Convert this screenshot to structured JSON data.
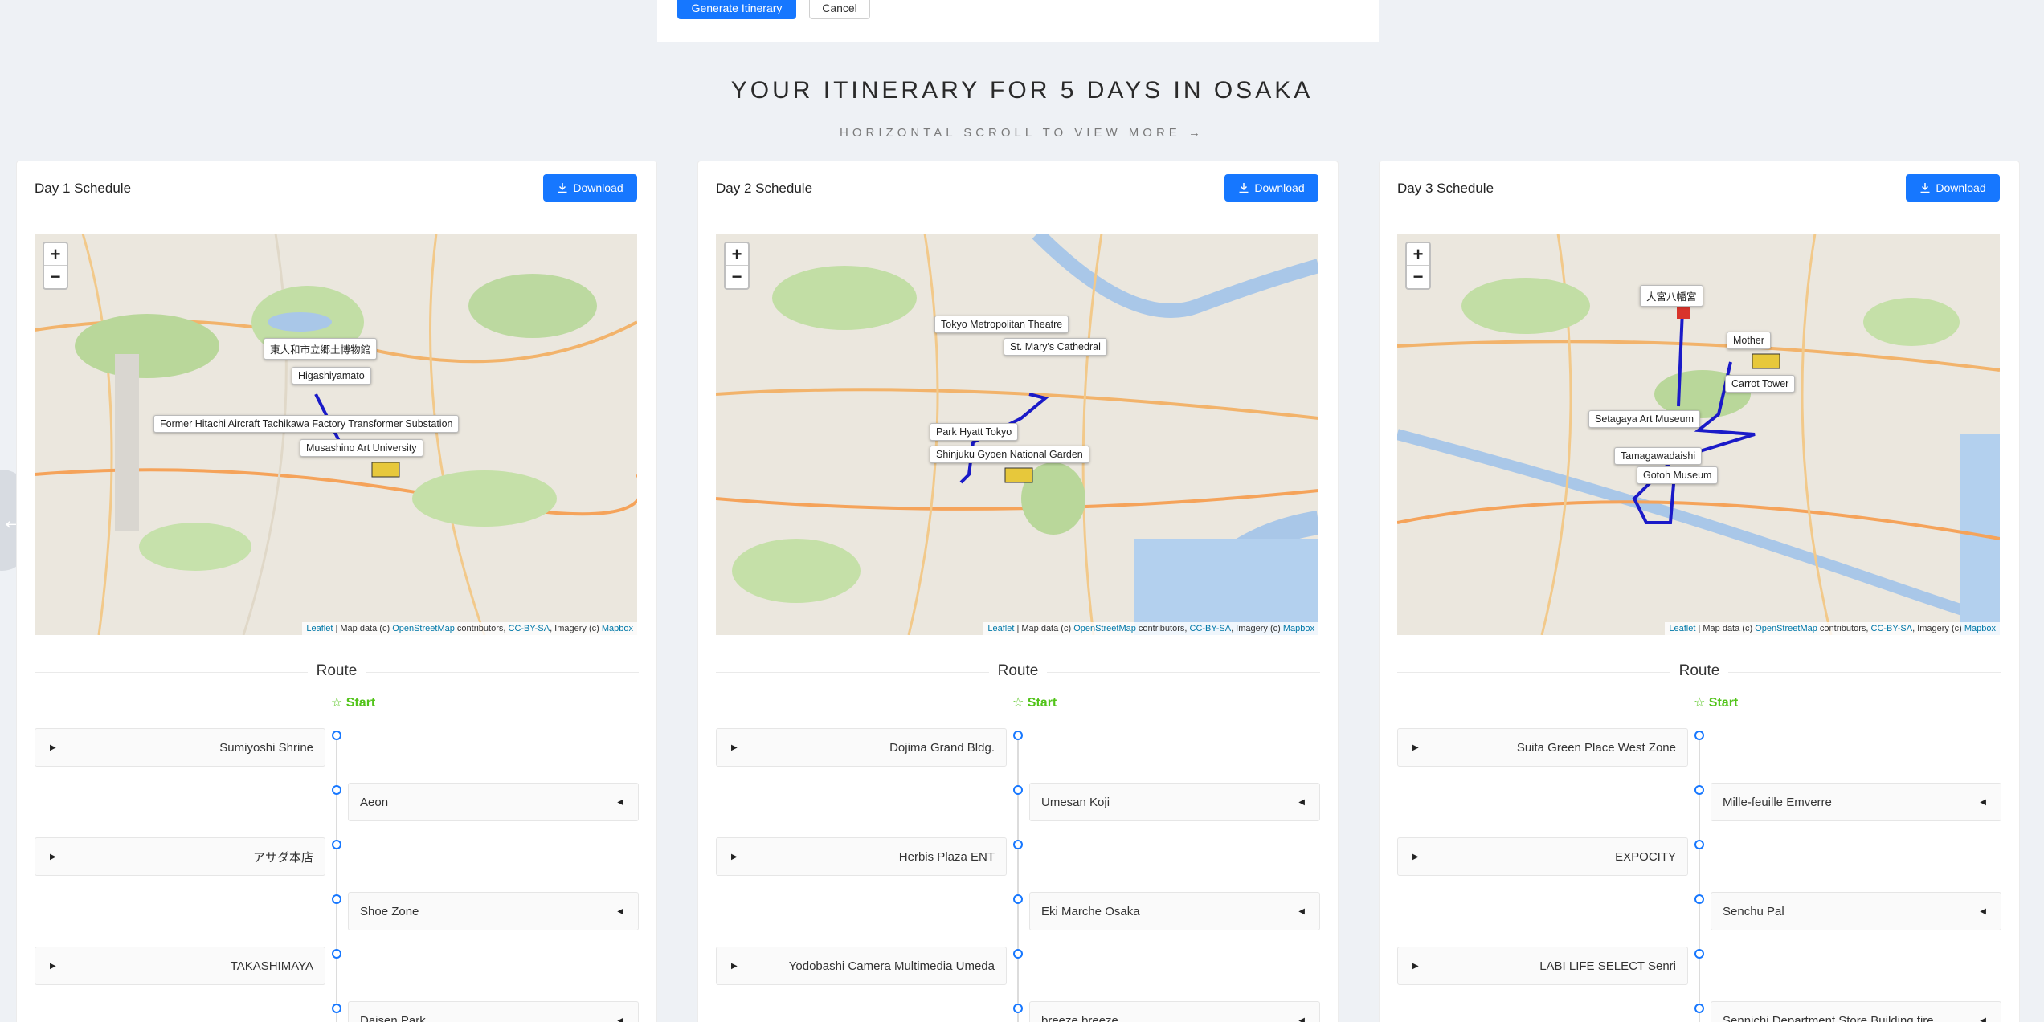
{
  "toolbar": {
    "generate_label": "Generate Itinerary",
    "cancel_label": "Cancel"
  },
  "heading": {
    "title": "YOUR ITINERARY FOR 5 DAYS IN OSAKA",
    "hint": "HORIZONTAL SCROLL TO VIEW MORE"
  },
  "colors": {
    "accent": "#1677ff",
    "start": "#52c41a",
    "route_line": "#1a1ac8"
  },
  "days": [
    {
      "title": "Day 1 Schedule",
      "download_label": "Download",
      "map": {
        "labels": [
          "東大和市立郷土博物館",
          "Higashiyamato",
          "Former Hitachi Aircraft Tachikawa Factory Transformer Substation",
          "Musashino Art University"
        ]
      },
      "route_label": "Route",
      "start_label": "Start",
      "stops": [
        "Sumiyoshi Shrine",
        "Aeon",
        "アサダ本店",
        "Shoe Zone",
        "TAKASHIMAYA",
        "Daisen Park"
      ]
    },
    {
      "title": "Day 2 Schedule",
      "download_label": "Download",
      "map": {
        "labels": [
          "Tokyo Metropolitan Theatre",
          "St. Mary's Cathedral",
          "Park Hyatt Tokyo",
          "Shinjuku Gyoen National Garden"
        ]
      },
      "route_label": "Route",
      "start_label": "Start",
      "stops": [
        "Dojima Grand Bldg.",
        "Umesan Koji",
        "Herbis Plaza ENT",
        "Eki Marche Osaka",
        "Yodobashi Camera Multimedia Umeda",
        "breeze breeze"
      ]
    },
    {
      "title": "Day 3 Schedule",
      "download_label": "Download",
      "map": {
        "labels": [
          "大宮八幡宮",
          "Mother",
          "Carrot Tower",
          "Setagaya Art Museum",
          "Tamagawadaishi",
          "Gotoh Museum"
        ]
      },
      "route_label": "Route",
      "start_label": "Start",
      "stops": [
        "Suita Green Place West Zone",
        "Mille-feuille Emverre",
        "EXPOCITY",
        "Senchu Pal",
        "LABI LIFE SELECT Senri",
        "Sennichi Department Store Building fire"
      ]
    }
  ],
  "map_attribution": {
    "leaflet": "Leaflet",
    "map_data": "| Map data (c)",
    "osm": "OpenStreetMap",
    "contributors": "contributors,",
    "license": "CC-BY-SA",
    "imagery": ", Imagery (c)",
    "mapbox": "Mapbox"
  },
  "zoom": {
    "in": "+",
    "out": "−"
  }
}
